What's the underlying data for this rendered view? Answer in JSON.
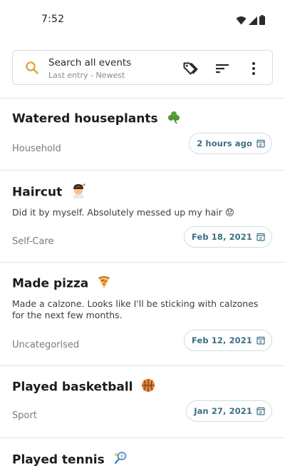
{
  "status_bar": {
    "time": "7:52",
    "icons": [
      "wifi-icon",
      "cell-signal-icon",
      "battery-icon"
    ]
  },
  "search": {
    "title": "Search all events",
    "subtitle": "Last entry - Newest",
    "icons": [
      "search-icon",
      "tag-icon",
      "sort-icon",
      "more-vert-icon"
    ]
  },
  "colors": {
    "accent": "#d9a637",
    "date_text": "#3f6f85",
    "divider": "#e2e2e2"
  },
  "events": [
    {
      "title": "Watered houseplants",
      "emoji": "shamrock-icon",
      "description": "",
      "category": "Household",
      "date": "2 hours ago"
    },
    {
      "title": "Haircut",
      "emoji": "haircut-icon",
      "description": "Did it by myself. Absolutely messed up my hair 😟",
      "category": "Self-Care",
      "date": "Feb 18, 2021"
    },
    {
      "title": "Made pizza",
      "emoji": "pizza-icon",
      "description": "Made a calzone. Looks like I'll be sticking with calzones for the next few months.",
      "category": "Uncategorised",
      "date": "Feb 12, 2021"
    },
    {
      "title": "Played basketball",
      "emoji": "basketball-icon",
      "description": "",
      "category": "Sport",
      "date": "Jan 27, 2021"
    },
    {
      "title": "Played tennis",
      "emoji": "tennis-icon",
      "description": "",
      "category": "",
      "date": ""
    }
  ]
}
